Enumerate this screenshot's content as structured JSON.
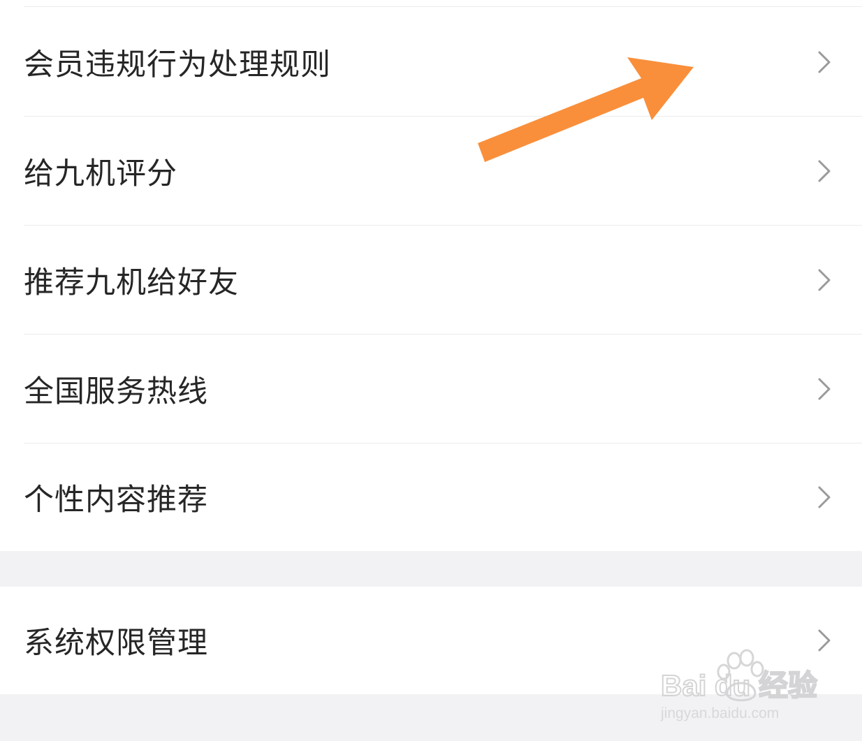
{
  "menu_group_1": [
    {
      "label": "会员违规行为处理规则"
    },
    {
      "label": "给九机评分"
    },
    {
      "label": "推荐九机给好友"
    },
    {
      "label": "全国服务热线"
    },
    {
      "label": "个性内容推荐"
    }
  ],
  "menu_group_2": [
    {
      "label": "系统权限管理"
    }
  ],
  "annotation": {
    "arrow_color": "#f98f3b",
    "icon": "orange-arrow-icon"
  },
  "watermark": {
    "brand": "Bai du 经验",
    "url": "jingyan.baidu.com"
  },
  "icons": {
    "row_chevron": "chevron-right-icon"
  }
}
